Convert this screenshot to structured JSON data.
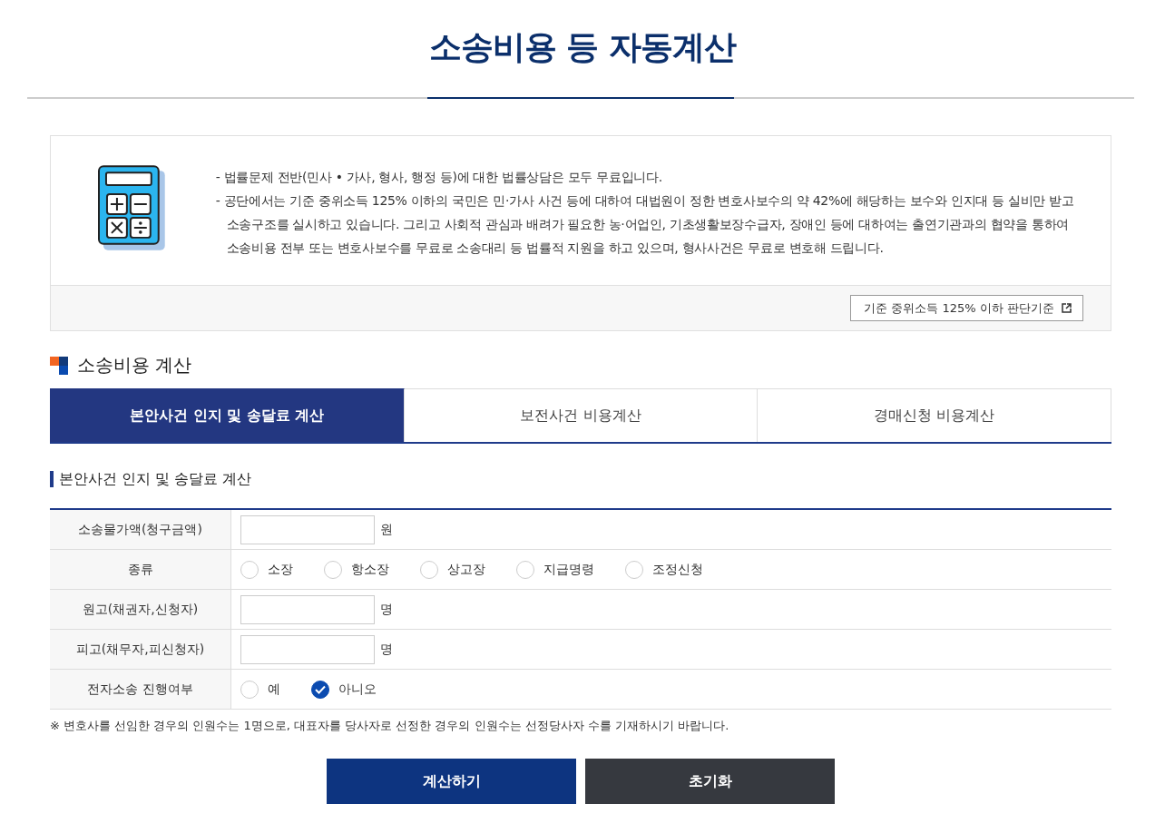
{
  "title": "소송비용 등 자동계산",
  "info": {
    "bullets": [
      "- 법률문제 전반(민사 • 가사, 형사, 행정 등)에 대한 법률상담은 모두 무료입니다.",
      "- 공단에서는 기준 중위소득 125% 이하의 국민은 민·가사 사건 등에 대하여 대법원이 정한 변호사보수의 약 42%에 해당하는 보수와 인지대 등 실비만 받고 소송구조를 실시하고 있습니다. 그리고 사회적 관심과 배려가 필요한 농·어업인, 기초생활보장수급자, 장애인 등에 대하여는 출연기관과의 협약을 통하여 소송비용 전부 또는 변호사보수를 무료로 소송대리 등 법률적 지원을 하고 있으며, 형사사건은 무료로 변호해 드립니다."
    ],
    "link": "기준 중위소득 125% 이하 판단기준"
  },
  "section_title": "소송비용 계산",
  "tabs": [
    {
      "label": "본안사건 인지 및 송달료 계산",
      "selected": true
    },
    {
      "label": "보전사건 비용계산",
      "selected": false
    },
    {
      "label": "경매신청 비용계산",
      "selected": false
    }
  ],
  "form_title": "본안사건 인지 및 송달료 계산",
  "rows": [
    {
      "kind": "input",
      "label": "소송물가액(청구금액)",
      "unit": "원"
    },
    {
      "kind": "radio",
      "label": "종류",
      "options": [
        {
          "label": "소장",
          "selected": false
        },
        {
          "label": "항소장",
          "selected": false
        },
        {
          "label": "상고장",
          "selected": false
        },
        {
          "label": "지급명령",
          "selected": false
        },
        {
          "label": "조정신청",
          "selected": false
        }
      ]
    },
    {
      "kind": "input",
      "label": "원고(채권자,신청자)",
      "unit": "명"
    },
    {
      "kind": "input",
      "label": "피고(채무자,피신청자)",
      "unit": "명"
    },
    {
      "kind": "radio",
      "label": "전자소송 진행여부",
      "options": [
        {
          "label": "예",
          "selected": false
        },
        {
          "label": "아니오",
          "selected": true
        }
      ]
    }
  ],
  "note": "※ 변호사를 선임한 경우의 인원수는 1명으로, 대표자를 당사자로 선정한 경우의 인원수는 선정당사자 수를 기재하시기 바랍니다.",
  "buttons": [
    {
      "kind": "primary",
      "label": "계산하기"
    },
    {
      "kind": "secondary",
      "label": "초기화"
    }
  ]
}
